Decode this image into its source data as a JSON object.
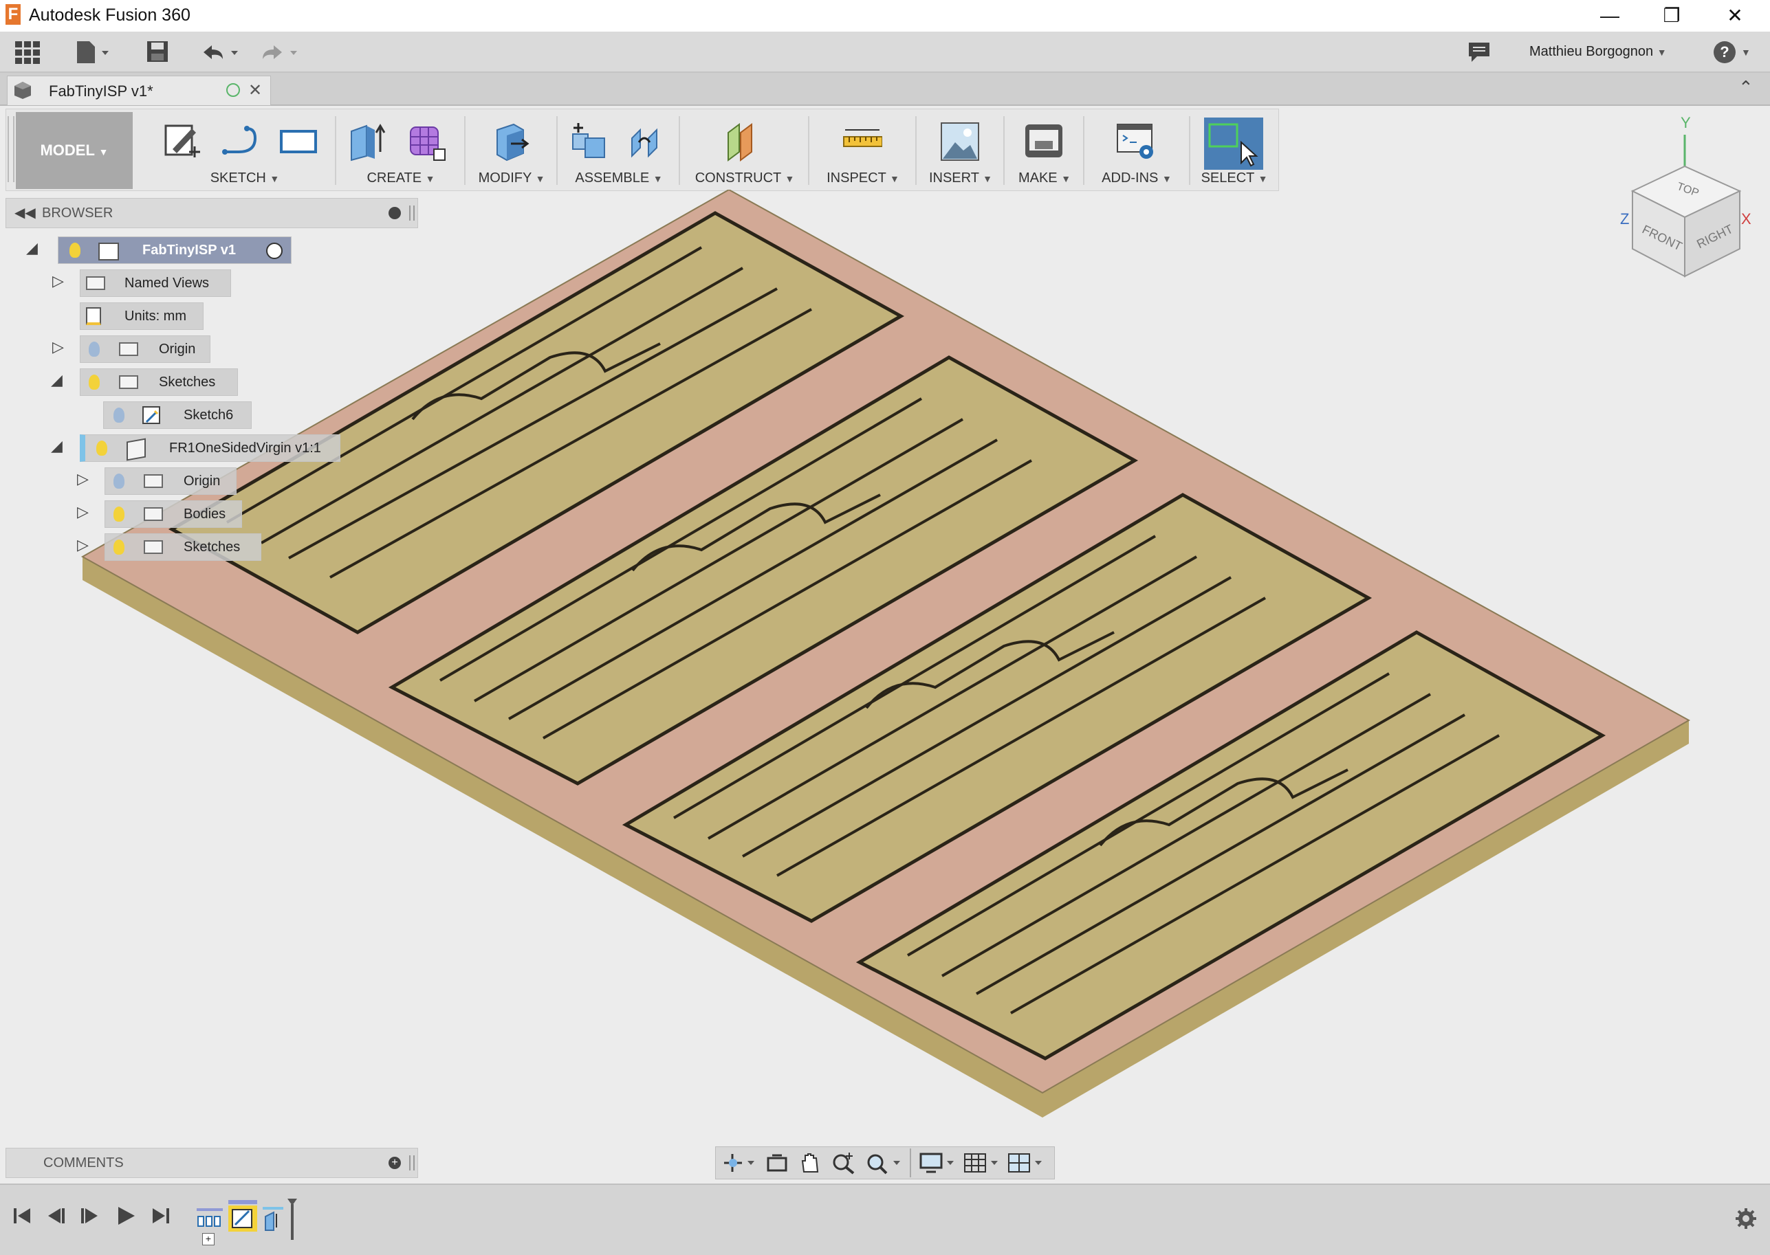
{
  "window": {
    "title": "Autodesk Fusion 360",
    "minimize": "—",
    "restore": "❐",
    "close": "✕"
  },
  "quick_access": {
    "user_name": "Matthieu Borgognon",
    "help": "?"
  },
  "document": {
    "tab_title": "FabTinyISP v1*",
    "tab_close": "✕"
  },
  "toolbar": {
    "workspace": "MODEL",
    "groups": {
      "sketch": "SKETCH",
      "create": "CREATE",
      "modify": "MODIFY",
      "assemble": "ASSEMBLE",
      "construct": "CONSTRUCT",
      "inspect": "INSPECT",
      "insert": "INSERT",
      "make": "MAKE",
      "addins": "ADD-INS",
      "select": "SELECT"
    }
  },
  "viewcube": {
    "top": "TOP",
    "front": "FRONT",
    "right": "RIGHT",
    "x": "X",
    "y": "Y",
    "z": "Z"
  },
  "browser": {
    "title": "BROWSER",
    "root": "FabTinyISP v1",
    "named_views": "Named Views",
    "units": "Units: mm",
    "origin": "Origin",
    "sketches": "Sketches",
    "sketch6": "Sketch6",
    "component": "FR1OneSidedVirgin v1:1",
    "comp_origin": "Origin",
    "comp_bodies": "Bodies",
    "comp_sketches": "Sketches"
  },
  "comments": {
    "title": "COMMENTS"
  },
  "colors": {
    "board_copper": "#d2a996",
    "board_trace": "#c2b27a",
    "board_edge": "#b09e62",
    "select_active": "#4a7fb5",
    "toolbar_bg": "#e7e7e7"
  }
}
